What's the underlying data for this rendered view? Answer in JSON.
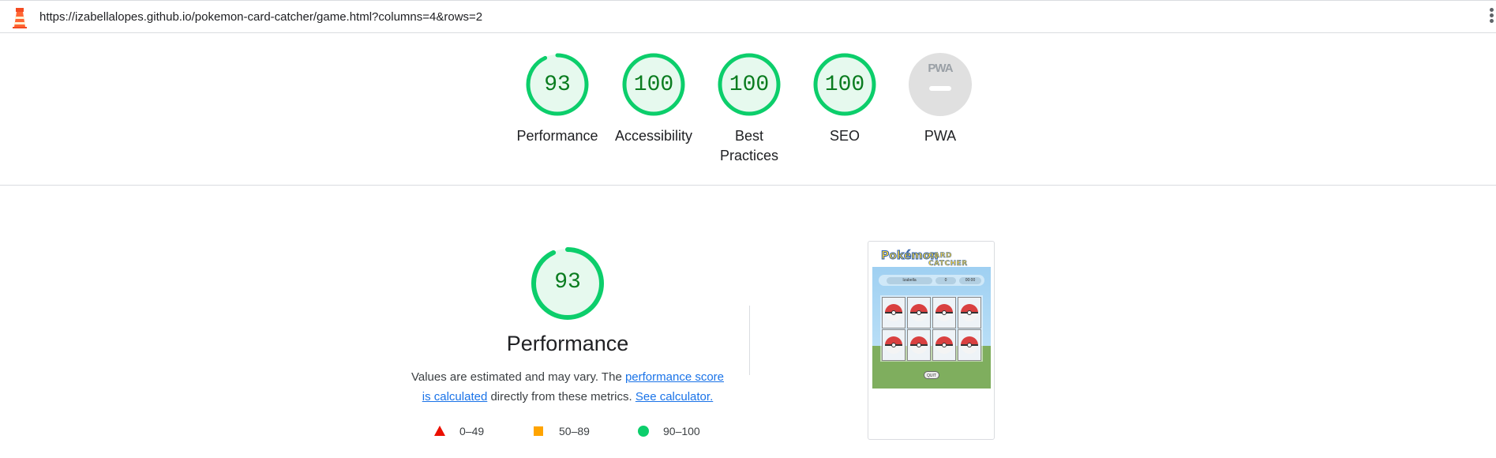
{
  "browser": {
    "url": "https://izabellalopes.github.io/pokemon-card-catcher/game.html?columns=4&rows=2"
  },
  "summary_gauges": [
    {
      "label": "Performance",
      "score": "93",
      "fraction": 0.93
    },
    {
      "label": "Accessibility",
      "score": "100",
      "fraction": 1.0
    },
    {
      "label": "Best Practices",
      "score": "100",
      "fraction": 1.0
    },
    {
      "label": "SEO",
      "score": "100",
      "fraction": 1.0
    },
    {
      "label": "PWA",
      "score": "",
      "fraction": 0
    }
  ],
  "pwa_badge_text": "PWA",
  "performance": {
    "score": "93",
    "fraction": 0.93,
    "title": "Performance",
    "desc_prefix": "Values are estimated and may vary. The ",
    "link_score": "performance score is calculated",
    "desc_middle": " directly from these metrics. ",
    "link_calc": "See calculator."
  },
  "legend": [
    {
      "range": "0–49",
      "color": "#eb0f00"
    },
    {
      "range": "50–89",
      "color": "#ffa400"
    },
    {
      "range": "90–100",
      "color": "#0cce6b"
    }
  ],
  "screenshot": {
    "logo_word": "Pokémon",
    "logo_sub": "CARD CATCHER",
    "player_name": "Izabella",
    "score": "0",
    "timer": "00:00",
    "quit_label": "QUIT"
  },
  "colors": {
    "pass": "#0cce6b",
    "pass_fill": "#e6f9ee",
    "pass_text": "#0a7c1f",
    "na": "#e0e0e0",
    "link": "#1a73e8"
  }
}
